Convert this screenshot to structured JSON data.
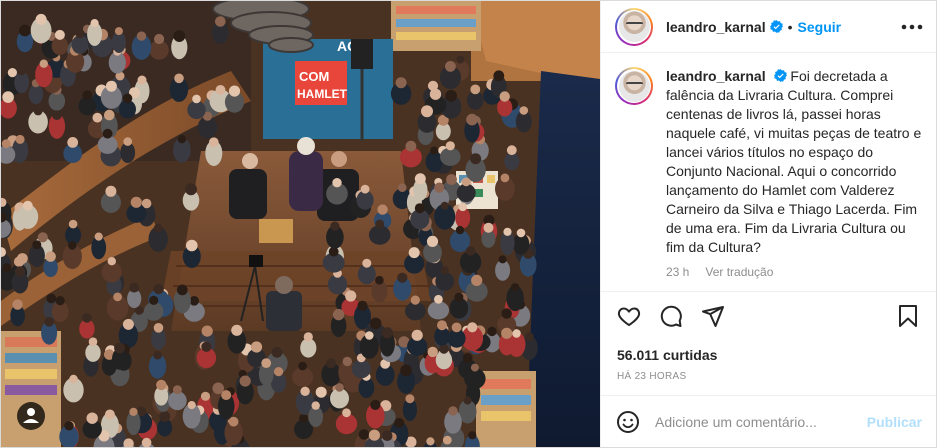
{
  "post": {
    "username": "leandro_karnal",
    "follow_label": "Seguir",
    "separator": "•",
    "caption_text": "Foi decretada a falência da Livraria Cultura. Comprei centenas de livros lá, passei horas naquele café, vi muitas peças de teatro e lancei vários títulos no espaço do Conjunto Nacional. Aqui o concorrido lançamento do Hamlet com Valderez Carneiro da Silva e Thiago Lacerda. Fim de uma era. Fim da Livraria Cultura ou fim da Cultura?",
    "caption_age": "23 h",
    "translate_label": "Ver tradução",
    "likes_label": "56.011 curtidas",
    "posted_ago": "HÁ 23 HORAS",
    "comment_placeholder": "Adicione um comentário...",
    "publish_label": "Publicar"
  },
  "photo": {
    "banner_line1": "COM",
    "banner_line2": "HAMLET",
    "banner_top": "AG"
  },
  "icons": {
    "verified": "verified-badge-icon",
    "more": "more-options-icon",
    "like": "heart-icon",
    "comment": "comment-icon",
    "share": "share-icon",
    "save": "bookmark-icon",
    "emoji": "emoji-icon"
  },
  "colors": {
    "link_blue": "#0095f6",
    "publish_disabled": "#b2dffc",
    "muted": "#8e8e8e",
    "text": "#262626",
    "banner_blue": "#2a6f96"
  }
}
